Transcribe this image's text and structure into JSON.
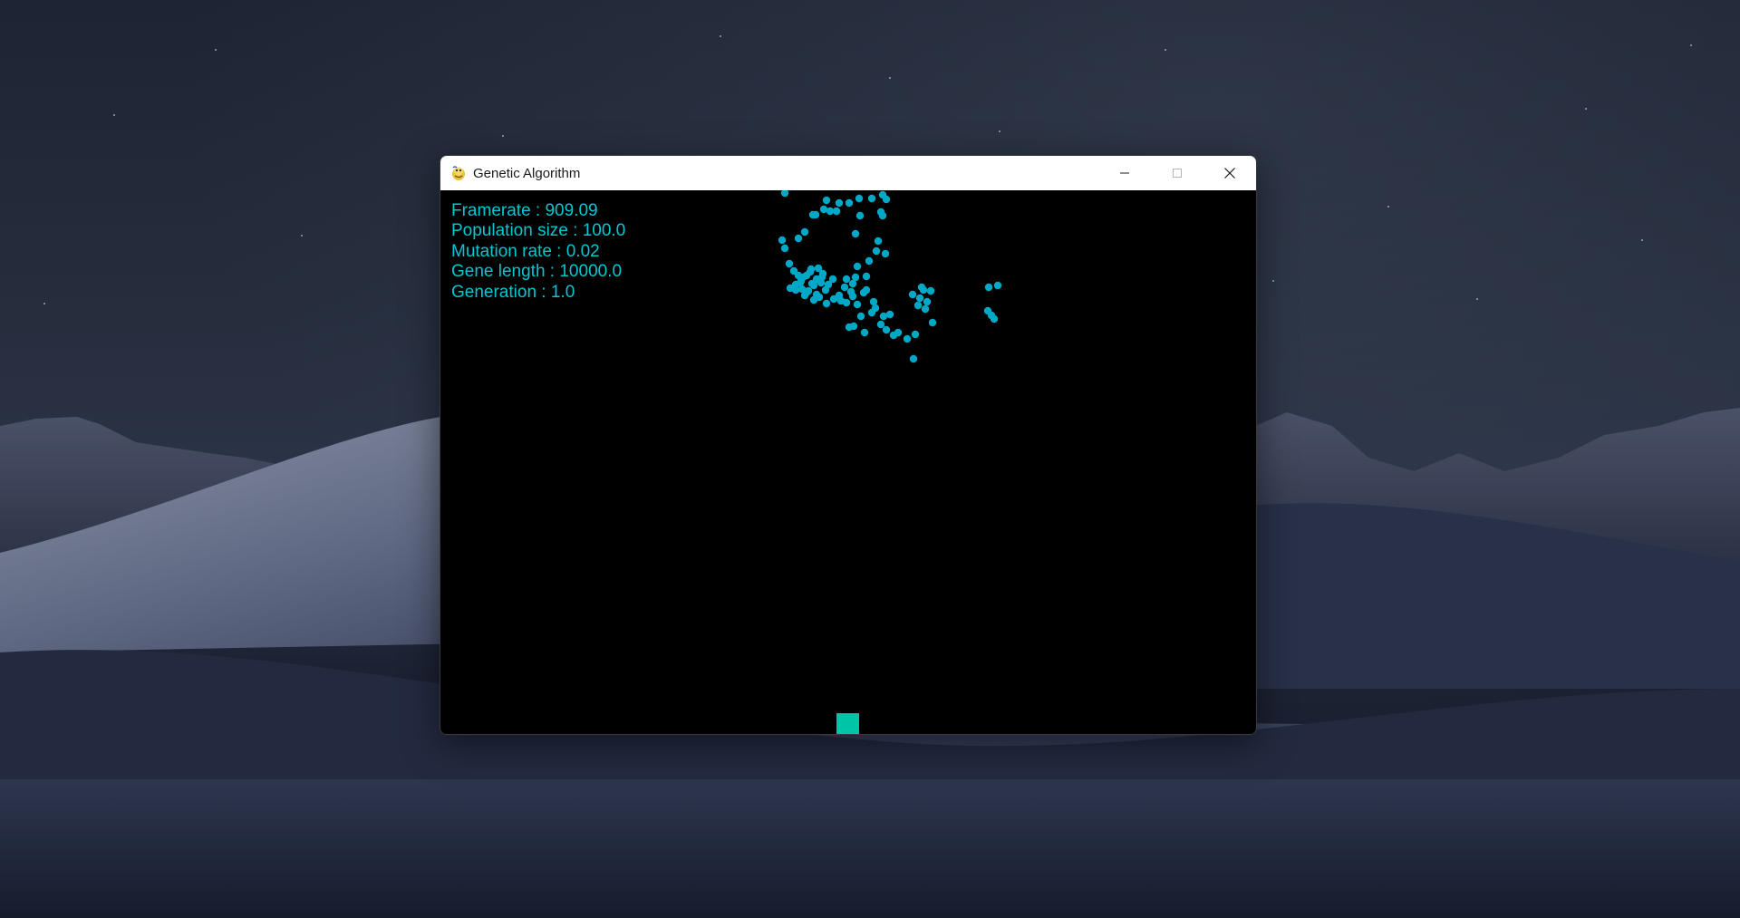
{
  "window": {
    "title": "Genetic Algorithm",
    "app_icon": "python-snake-icon",
    "controls": [
      "minimize-icon",
      "maximize-icon",
      "close-icon"
    ]
  },
  "stats": {
    "framerate": "Framerate : 909.09",
    "population_size": "Population size : 100.0",
    "mutation_rate": "Mutation rate : 0.02",
    "gene_length": "Gene length : 10000.0",
    "generation": "Generation : 1.0"
  },
  "colors": {
    "text": "#00c8d2",
    "agent": "#00a8c8",
    "target": "#00c4a6",
    "canvas_bg": "#000000",
    "titlebar_bg": "#ffffff"
  }
}
